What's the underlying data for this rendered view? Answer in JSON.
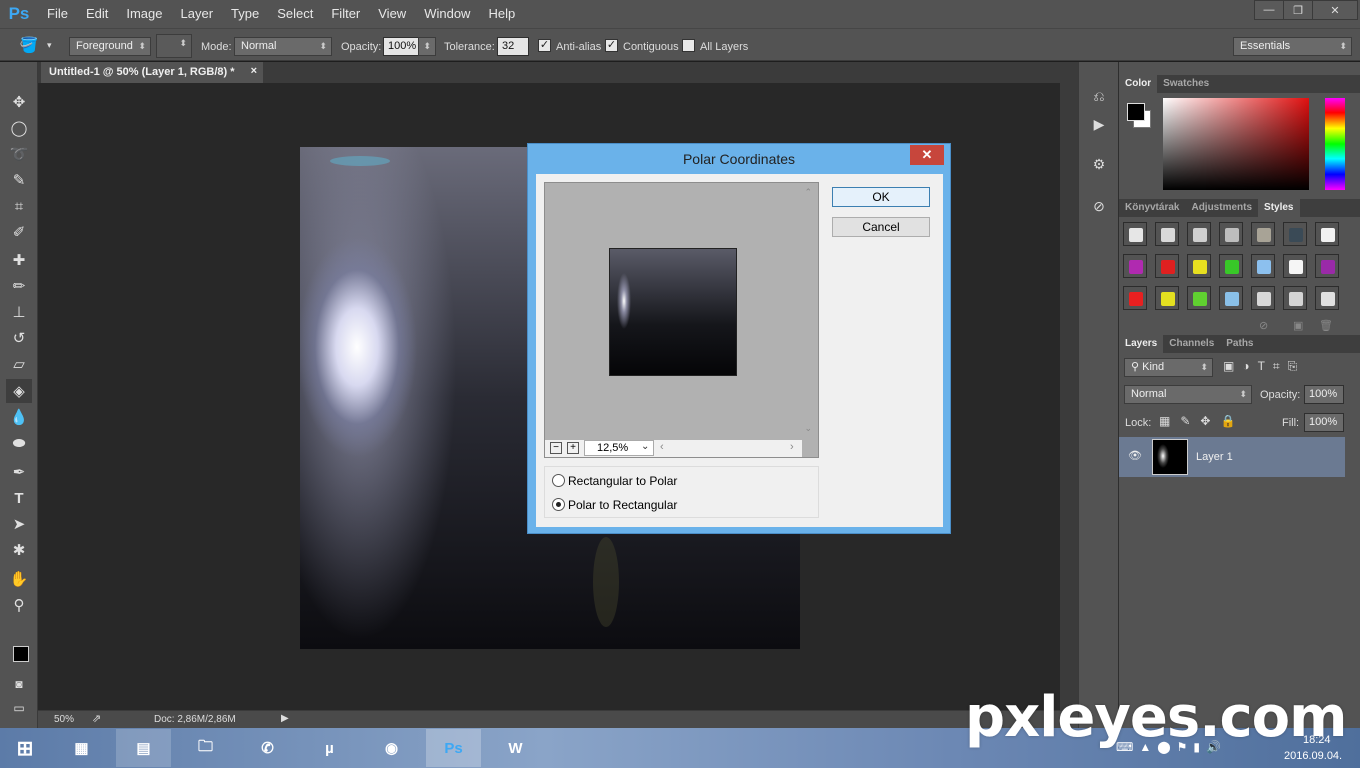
{
  "app": {
    "logo": "Ps"
  },
  "menu": [
    "File",
    "Edit",
    "Image",
    "Layer",
    "Type",
    "Select",
    "Filter",
    "View",
    "Window",
    "Help"
  ],
  "window_controls": [
    "—",
    "❐",
    "✕"
  ],
  "options": {
    "fill_source": "Foreground",
    "mode_label": "Mode:",
    "mode_value": "Normal",
    "opacity_label": "Opacity:",
    "opacity_value": "100%",
    "tolerance_label": "Tolerance:",
    "tolerance_value": "32",
    "anti_alias": "Anti-alias",
    "contiguous": "Contiguous",
    "all_layers": "All Layers",
    "workspace": "Essentials"
  },
  "document": {
    "tab_title": "Untitled-1 @ 50% (Layer 1, RGB/8) *",
    "tab_close": "×",
    "zoom": "50%",
    "doc_info": "Doc: 2,86M/2,86M"
  },
  "panels": {
    "color_tabs": [
      "Color",
      "Swatches"
    ],
    "style_tabs": [
      "Könyvtárak",
      "Adjustments",
      "Styles"
    ],
    "layers_tabs": [
      "Layers",
      "Channels",
      "Paths"
    ],
    "kind_label": "Kind",
    "blend_mode": "Normal",
    "opacity_label": "Opacity:",
    "opacity_value": "100%",
    "lock_label": "Lock:",
    "fill_label": "Fill:",
    "fill_value": "100%",
    "layer_name": "Layer 1",
    "style_swatches": [
      "#e6e6e6",
      "#d9d9d9",
      "#cfcfcf",
      "#bdbdbd",
      "#a8a396",
      "#3a4a56",
      "#f2f2f2",
      "#b02ab0",
      "#e02020",
      "#e8e020",
      "#38c828",
      "#8cc0ee",
      "#f5f5f5",
      "#9a2aa8",
      "#e82020",
      "#e4e020",
      "#60d030",
      "#8ac0e8",
      "#d8d8d8",
      "#d4d4d4",
      "#e0e0e0"
    ]
  },
  "dialog": {
    "title": "Polar Coordinates",
    "close": "✕",
    "ok": "OK",
    "cancel": "Cancel",
    "zoom_value": "12,5%",
    "option_rect_to_polar": "Rectangular to Polar",
    "option_polar_to_rect": "Polar to Rectangular",
    "selected_option": "Polar to Rectangular"
  },
  "taskbar": {
    "time": "18:24",
    "date": "2016.09.04."
  },
  "watermark": "pxleyes.com"
}
